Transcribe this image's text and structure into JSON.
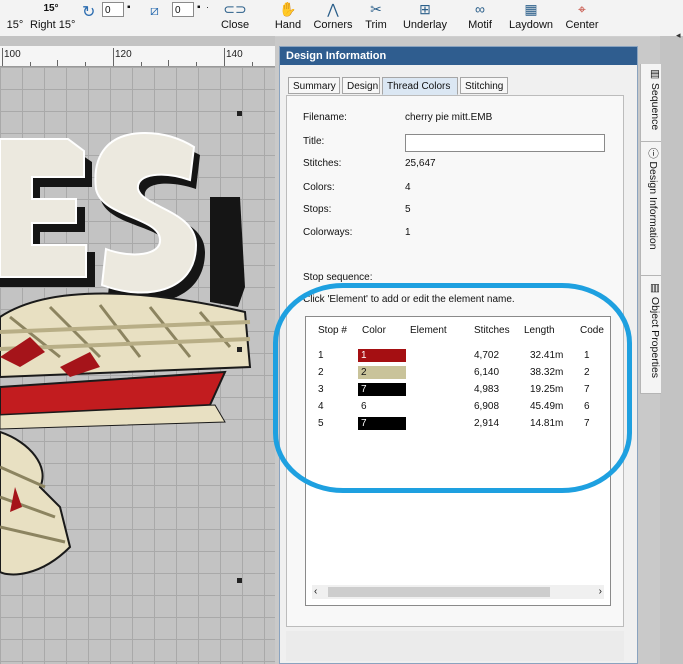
{
  "toolbar": {
    "rotate_left_label": "15°",
    "rotate_right_value": "15°",
    "rotate_right_label": "Right 15°",
    "spin1_value": "0",
    "spin2_value": "0",
    "buttons": [
      {
        "label": "Close",
        "icon": "close-shape-icon"
      },
      {
        "label": "Hand",
        "icon": "hand-icon"
      },
      {
        "label": "Corners",
        "icon": "corners-icon"
      },
      {
        "label": "Trim",
        "icon": "scissors-icon"
      },
      {
        "label": "Underlay",
        "icon": "underlay-icon"
      },
      {
        "label": "Motif",
        "icon": "motif-icon"
      },
      {
        "label": "Laydown",
        "icon": "laydown-icon"
      },
      {
        "label": "Center",
        "icon": "center-icon"
      }
    ]
  },
  "ruler": {
    "labels": [
      "100",
      "120",
      "140"
    ]
  },
  "panel": {
    "title": "Design Information",
    "tabs": [
      "Summary",
      "Design",
      "Thread Colors",
      "Stitching"
    ],
    "active_tab": "Thread Colors",
    "info": {
      "filename_label": "Filename:",
      "filename_value": "cherry pie mitt.EMB",
      "title_label": "Title:",
      "title_value": "",
      "stitches_label": "Stitches:",
      "stitches_value": "25,647",
      "colors_label": "Colors:",
      "colors_value": "4",
      "stops_label": "Stops:",
      "stops_value": "5",
      "colorways_label": "Colorways:",
      "colorways_value": "1"
    },
    "stop_sequence_label": "Stop sequence:",
    "click_hint": "Click 'Element' to add or edit the element name.",
    "table": {
      "headers": [
        "Stop #",
        "Color",
        "Element",
        "Stitches",
        "Length",
        "Code"
      ],
      "rows": [
        {
          "stop": "1",
          "color_label": "1",
          "color": "#a50f12",
          "element": "",
          "stitches": "4,702",
          "length": "32.41m",
          "code": "1"
        },
        {
          "stop": "2",
          "color_label": "2",
          "color": "#c9c39a",
          "element": "",
          "stitches": "6,140",
          "length": "38.32m",
          "code": "2"
        },
        {
          "stop": "3",
          "color_label": "7",
          "color": "#000000",
          "element": "",
          "stitches": "4,983",
          "length": "19.25m",
          "code": "7"
        },
        {
          "stop": "4",
          "color_label": "6",
          "color": "#ffffff",
          "element": "",
          "stitches": "6,908",
          "length": "45.49m",
          "code": "6"
        },
        {
          "stop": "5",
          "color_label": "7",
          "color": "#000000",
          "element": "",
          "stitches": "2,914",
          "length": "14.81m",
          "code": "7"
        }
      ]
    }
  },
  "side_tabs": [
    "Sequence",
    "Design Information",
    "Object Properties"
  ],
  "annotation_color": "#1ea0e0"
}
